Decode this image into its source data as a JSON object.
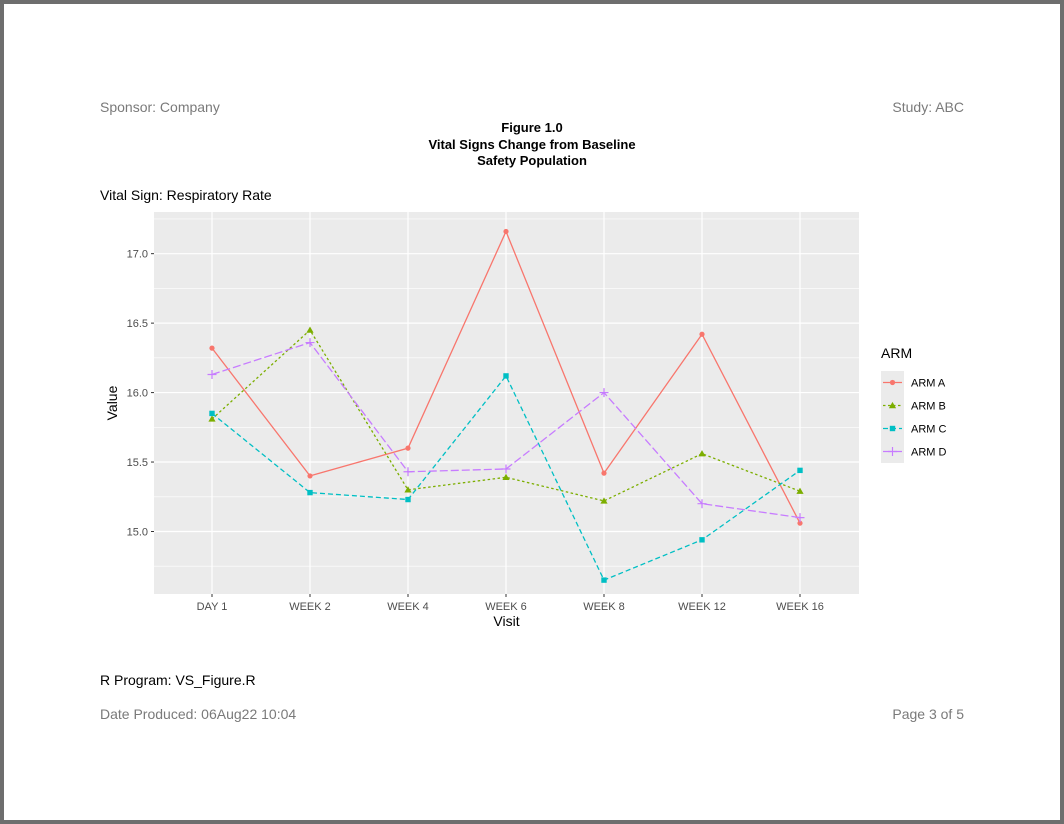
{
  "header": {
    "sponsor": "Sponsor: Company",
    "study": "Study: ABC"
  },
  "titles": {
    "line1": "Figure 1.0",
    "line2": "Vital Signs Change from Baseline",
    "line3": "Safety Population"
  },
  "subtitle": "Vital Sign: Respiratory Rate",
  "footer": {
    "program": "R Program: VS_Figure.R",
    "date_produced": "Date Produced: 06Aug22 10:04",
    "page": "Page  3  of  5"
  },
  "chart_data": {
    "type": "line",
    "xlabel": "Visit",
    "ylabel": "Value",
    "categories": [
      "DAY 1",
      "WEEK 2",
      "WEEK 4",
      "WEEK 6",
      "WEEK 8",
      "WEEK 12",
      "WEEK 16"
    ],
    "ylim": [
      14.55,
      17.3
    ],
    "yticks": [
      15.0,
      15.5,
      16.0,
      16.5,
      17.0
    ],
    "ytick_labels": [
      "15.0",
      "15.5",
      "16.0",
      "16.5",
      "17.0"
    ],
    "grid": true,
    "panel_background": "#ebebeb",
    "legend_title": "ARM",
    "legend_position": "right",
    "series": [
      {
        "name": "ARM A",
        "color": "#f8766d",
        "marker": "circle",
        "dash": "solid",
        "values": [
          16.32,
          15.4,
          15.6,
          17.16,
          15.42,
          16.42,
          15.06
        ]
      },
      {
        "name": "ARM B",
        "color": "#7cae00",
        "marker": "triangle",
        "dash": "dotted",
        "values": [
          15.81,
          16.45,
          15.3,
          15.39,
          15.22,
          15.56,
          15.29
        ]
      },
      {
        "name": "ARM C",
        "color": "#00bfc4",
        "marker": "square",
        "dash": "dashed",
        "values": [
          15.85,
          15.28,
          15.23,
          16.12,
          14.65,
          14.94,
          15.44
        ]
      },
      {
        "name": "ARM D",
        "color": "#c77cff",
        "marker": "plus",
        "dash": "longdash",
        "values": [
          16.13,
          16.36,
          15.43,
          15.45,
          16.0,
          15.2,
          15.1
        ]
      }
    ]
  }
}
